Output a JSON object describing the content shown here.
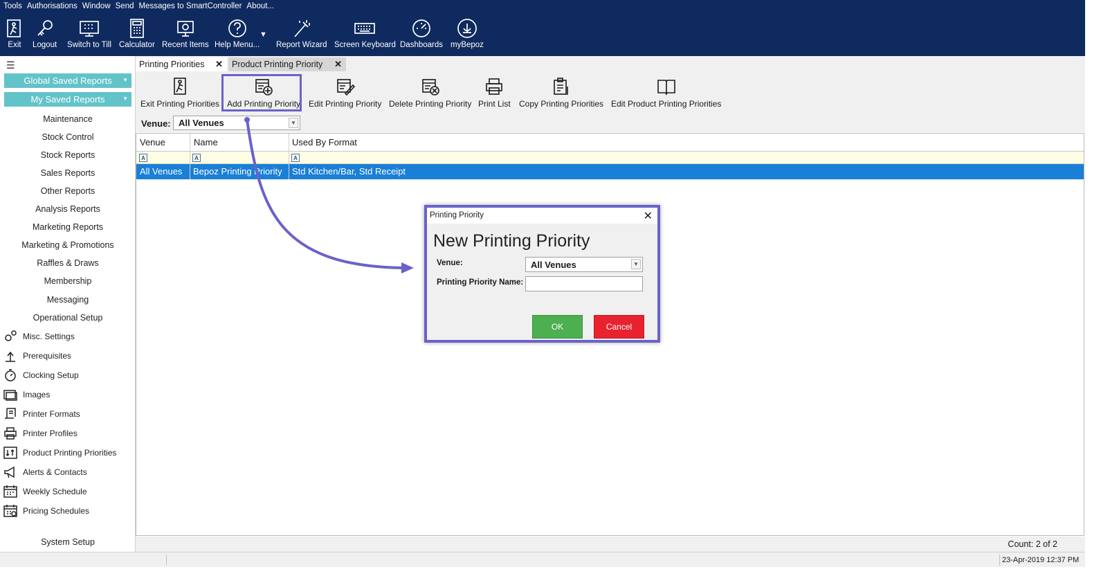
{
  "menu": [
    "Tools",
    "Authorisations",
    "Window",
    "Send",
    "Messages to SmartController",
    "About..."
  ],
  "toolbar": [
    {
      "label": "Exit",
      "icon": "exit-icon"
    },
    {
      "label": "Logout",
      "icon": "key-icon"
    },
    {
      "label": "Switch to Till",
      "icon": "till-icon"
    },
    {
      "label": "Calculator",
      "icon": "calculator-icon"
    },
    {
      "label": "Recent Items",
      "icon": "recent-icon"
    },
    {
      "label": "Help Menu...",
      "icon": "help-icon"
    },
    {
      "label": "Report Wizard",
      "icon": "wand-icon"
    },
    {
      "label": "Screen Keyboard",
      "icon": "keyboard-icon"
    },
    {
      "label": "Dashboards",
      "icon": "gauge-icon"
    },
    {
      "label": "myBepoz",
      "icon": "bepoz-icon"
    }
  ],
  "sidebar": {
    "saved": [
      "Global Saved Reports",
      "My Saved Reports"
    ],
    "sections": [
      "Maintenance",
      "Stock Control",
      "Stock Reports",
      "Sales Reports",
      "Other Reports",
      "Analysis Reports",
      "Marketing Reports",
      "Marketing & Promotions",
      "Raffles & Draws",
      "Membership",
      "Messaging",
      "Operational Setup"
    ],
    "tools": [
      {
        "label": "Misc. Settings",
        "icon": "gears-icon"
      },
      {
        "label": "Prerequisites",
        "icon": "branch-icon"
      },
      {
        "label": "Clocking Setup",
        "icon": "stopwatch-icon"
      },
      {
        "label": "Images",
        "icon": "images-icon"
      },
      {
        "label": "Printer Formats",
        "icon": "scroll-icon"
      },
      {
        "label": "Printer Profiles",
        "icon": "printer-icon"
      },
      {
        "label": "Product Printing Priorities",
        "icon": "priority-icon"
      },
      {
        "label": "Alerts & Contacts",
        "icon": "megaphone-icon"
      },
      {
        "label": "Weekly Schedule",
        "icon": "calendar-icon"
      },
      {
        "label": "Pricing Schedules",
        "icon": "calendar-price-icon"
      }
    ],
    "system_setup": "System Setup"
  },
  "tabs": [
    "Printing Priorities",
    "Product Printing Priority"
  ],
  "actions": [
    "Exit Printing Priorities",
    "Add Printing Priority",
    "Edit Printing Priority",
    "Delete Printing Priority",
    "Print List",
    "Copy Printing Priorities",
    "Edit Product Printing Priorities"
  ],
  "filter": {
    "label": "Venue:",
    "value": "All Venues"
  },
  "grid": {
    "columns": [
      "Venue",
      "Name",
      "Used By Format"
    ],
    "rows": [
      [
        "All Venues",
        "Bepoz Printing Priority",
        "Std Kitchen/Bar, Std Receipt"
      ]
    ]
  },
  "status": {
    "count": "Count: 2 of 2",
    "datetime": "23-Apr-2019   12:37 PM"
  },
  "dialog": {
    "title": "Printing Priority",
    "heading": "New Printing Priority",
    "venue_label": "Venue:",
    "venue_value": "All Venues",
    "name_label": "Printing Priority Name:",
    "name_value": "",
    "ok": "OK",
    "cancel": "Cancel"
  },
  "colors": {
    "appbar": "#0f2a5e",
    "saved_button": "#62c3c9",
    "selection": "#1a7fd6",
    "annotation": "#6a62c9",
    "ok": "#4caf50",
    "cancel": "#e8232f"
  }
}
